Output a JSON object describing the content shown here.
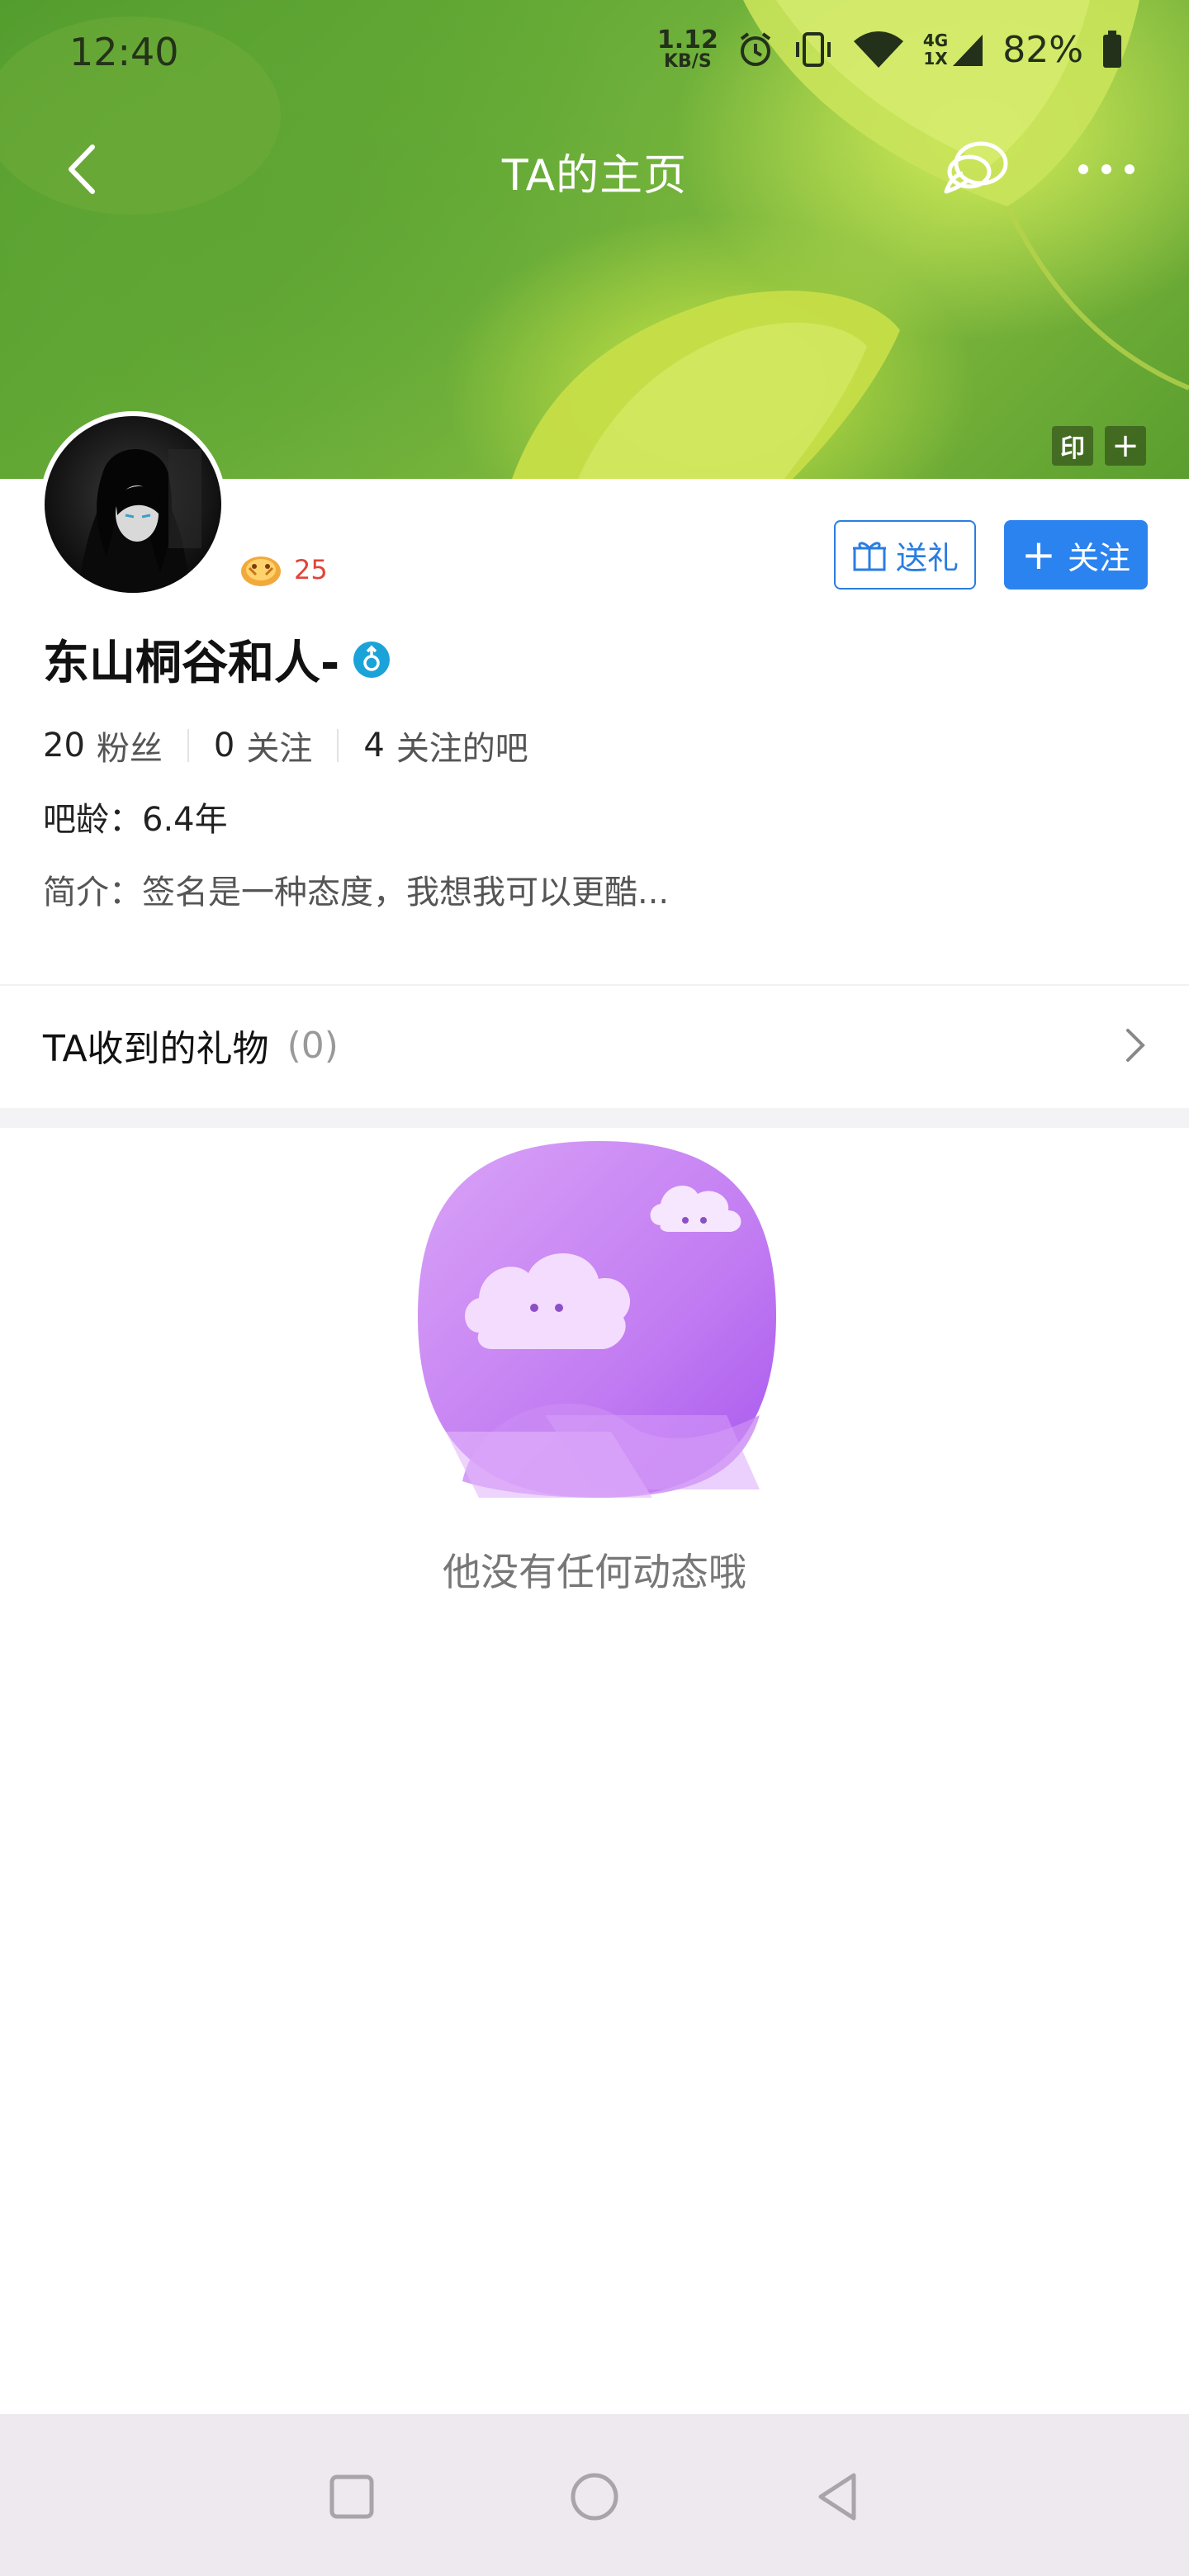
{
  "status_bar": {
    "time": "12:40",
    "net_speed_value": "1.12",
    "net_speed_unit": "KB/S",
    "network_type": "4G",
    "network_sub": "1X",
    "battery": "82%"
  },
  "nav": {
    "title": "TA的主页"
  },
  "cover": {
    "tag_print": "印",
    "tag_add": "+"
  },
  "profile": {
    "level": "25",
    "username": "东山桐谷和人-",
    "gift_button": "送礼",
    "follow_button": "关注",
    "follow_plus": "+",
    "stats": [
      {
        "value": "20",
        "label": "粉丝"
      },
      {
        "value": "0",
        "label": "关注"
      },
      {
        "value": "4",
        "label": "关注的吧"
      }
    ],
    "bar_age_label": "吧龄：",
    "bar_age_value": "6.4年",
    "bio_label": "简介：",
    "bio_value": "签名是一种态度，我想我可以更酷..."
  },
  "gifts": {
    "title": "TA收到的礼物",
    "count": "(0)"
  },
  "empty_state": {
    "message": "他没有任何动态哦"
  },
  "colors": {
    "accent_blue": "#2b83f0",
    "level_red": "#e0453a",
    "verify_cyan": "#1aa3d8",
    "empty_purple": "#c27cf2"
  }
}
